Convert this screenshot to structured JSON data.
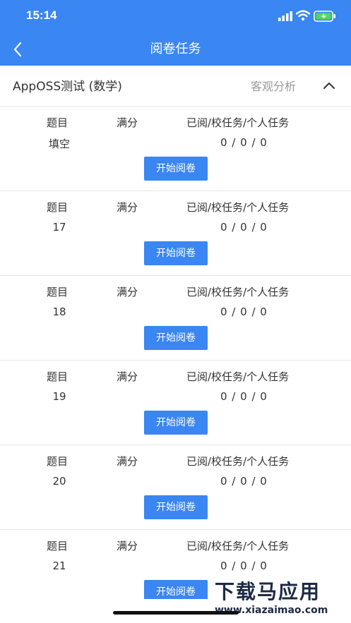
{
  "status_bar": {
    "time": "15:14"
  },
  "nav": {
    "title": "阅卷任务"
  },
  "exam": {
    "title": "AppOSS测试 (数学)",
    "analysis_label": "客观分析"
  },
  "labels": {
    "question": "题目",
    "full_score": "满分",
    "progress": "已阅/校任务/个人任务"
  },
  "tasks": [
    {
      "question": "填空",
      "full_score": "",
      "progress": "0 / 0 / 0",
      "button": "开始阅卷"
    },
    {
      "question": "17",
      "full_score": "",
      "progress": "0 / 0 / 0",
      "button": "开始阅卷"
    },
    {
      "question": "18",
      "full_score": "",
      "progress": "0 / 0 / 0",
      "button": "开始阅卷"
    },
    {
      "question": "19",
      "full_score": "",
      "progress": "0 / 0 / 0",
      "button": "开始阅卷"
    },
    {
      "question": "20",
      "full_score": "",
      "progress": "0 / 0 / 0",
      "button": "开始阅卷"
    },
    {
      "question": "21",
      "full_score": "",
      "progress": "0 / 0 / 0",
      "button": "开始阅卷"
    }
  ],
  "watermark": {
    "logo": "下载马应用",
    "url": "www.xiazaimao.com"
  },
  "colors": {
    "primary": "#3a86f2",
    "text": "#333333",
    "muted": "#999999",
    "divider": "#e6e6e6"
  }
}
